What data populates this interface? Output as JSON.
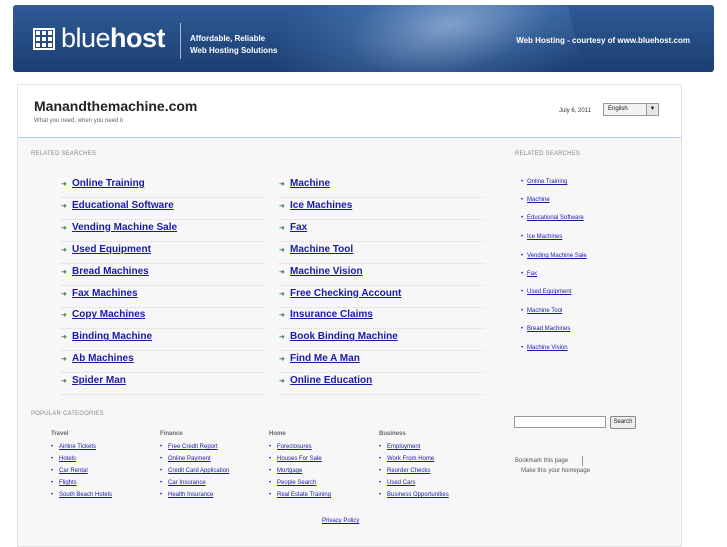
{
  "header": {
    "logo_light": "blue",
    "logo_bold": "host",
    "tagline_line1": "Affordable, Reliable",
    "tagline_line2": "Web Hosting Solutions",
    "courtesy": "Web Hosting - courtesy of www.bluehost.com"
  },
  "site": {
    "title": "Manandthemachine.com",
    "subtitle": "What you need, when you need it",
    "date": "July 6, 2011",
    "language": "English"
  },
  "related": {
    "label": "RELATED SEARCHES",
    "left": [
      "Online Training",
      "Educational Software",
      "Vending Machine Sale",
      "Used Equipment",
      "Bread Machines",
      "Fax Machines",
      "Copy Machines",
      "Binding Machine",
      "Ab Machines",
      "Spider Man"
    ],
    "right": [
      "Machine",
      "Ice Machines",
      "Fax",
      "Machine Tool",
      "Machine Vision",
      "Free Checking Account",
      "Insurance Claims",
      "Book Binding Machine",
      "Find Me A Man",
      "Online Education"
    ]
  },
  "sidebar": {
    "label": "RELATED SEARCHES",
    "items": [
      "Online Training",
      "Machine",
      "Educational Software",
      "Ice Machines",
      "Vending Machine Sale",
      "Fax",
      "Used Equipment",
      "Machine Tool",
      "Bread Machines",
      "Machine Vision"
    ],
    "search_button": "Search",
    "bookmark": "Bookmark this page",
    "homepage": "Make this your homepage"
  },
  "popular": {
    "label": "POPULAR CATEGORIES",
    "columns": [
      {
        "title": "Travel",
        "items": [
          "Airline Tickets",
          "Hotels",
          "Car Rental",
          "Flights",
          "South Beach Hotels"
        ]
      },
      {
        "title": "Finance",
        "items": [
          "Free Credit Report",
          "Online Payment",
          "Credit Card Application",
          "Car Insurance",
          "Health Insurance"
        ]
      },
      {
        "title": "Home",
        "items": [
          "Foreclosures",
          "Houses For Sale",
          "Mortgage",
          "People Search",
          "Real Estate Training"
        ]
      },
      {
        "title": "Business",
        "items": [
          "Employment",
          "Work From Home",
          "Reorder Checks",
          "Used Cars",
          "Business Opportunities"
        ]
      }
    ]
  },
  "footer": {
    "privacy": "Privacy Policy"
  }
}
